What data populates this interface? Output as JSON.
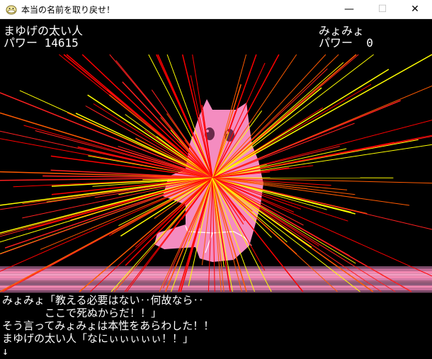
{
  "window": {
    "title": "本当の名前を取り戻せ！",
    "minimize_glyph": "—",
    "maximize_glyph": "☐",
    "close_glyph": "✕"
  },
  "hud": {
    "player1_name": "まゆげの太い人",
    "player1_power": "パワー 14615",
    "player2_name": "みょみょ",
    "player2_power": "パワー  0"
  },
  "dialog": {
    "line1": "みょみょ「教える必要はない‥何故なら‥",
    "line2": "ここで死ぬからだ！！」",
    "line3": "そう言ってみょみょは本性をあらわした！！",
    "line4": "まゆげの太い人「なにぃぃぃぃぃ！！」",
    "continue_arrow": "↓"
  },
  "colors": {
    "background": "#000000",
    "monster_pink": "#f48cc0",
    "beam_red": "#ff0000",
    "beam_yellow": "#ffff00",
    "floor_stripe_light": "#f28ab3",
    "floor_stripe_dark": "#8c5a7a"
  }
}
